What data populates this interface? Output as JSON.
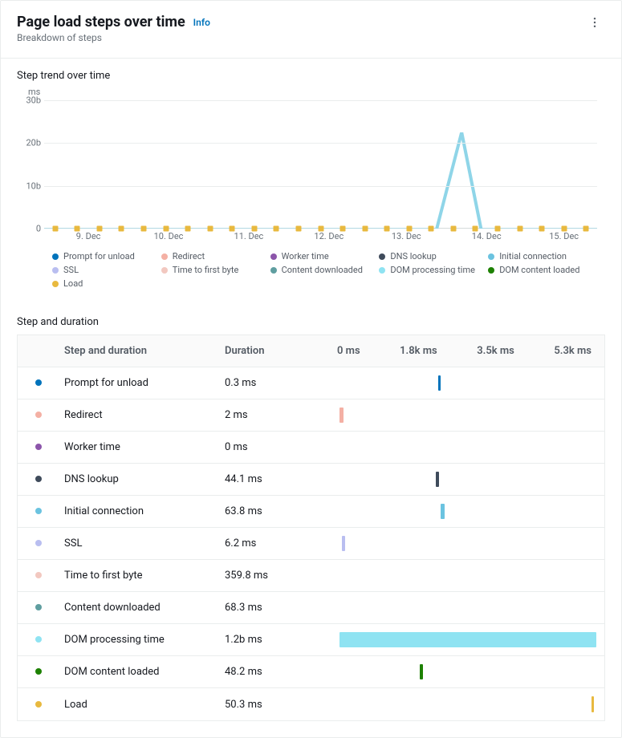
{
  "header": {
    "title": "Page load steps over time",
    "info": "Info",
    "subtitle": "Breakdown of steps"
  },
  "chart": {
    "title": "Step trend over time",
    "y_unit": "ms",
    "y_ticks": [
      "0",
      "10b",
      "20b",
      "30b"
    ],
    "x_ticks": [
      "9. Dec",
      "10. Dec",
      "11. Dec",
      "12. Dec",
      "13. Dec",
      "14. Dec",
      "15. Dec"
    ]
  },
  "legend": [
    {
      "label": "Prompt for unload",
      "color": "#0073bb"
    },
    {
      "label": "Redirect",
      "color": "#f4b0a4"
    },
    {
      "label": "Worker time",
      "color": "#8c55aa"
    },
    {
      "label": "DNS lookup",
      "color": "#3f4b5b"
    },
    {
      "label": "Initial connection",
      "color": "#6bc3e0"
    },
    {
      "label": "SSL",
      "color": "#b9bef0"
    },
    {
      "label": "Time to first byte",
      "color": "#f2c8c0"
    },
    {
      "label": "Content downloaded",
      "color": "#5f9ea0"
    },
    {
      "label": "DOM processing time",
      "color": "#8fe3f2"
    },
    {
      "label": "DOM content loaded",
      "color": "#1d8102"
    },
    {
      "label": "Load",
      "color": "#e8b93f"
    }
  ],
  "table": {
    "title": "Step and duration",
    "headers": {
      "step": "Step and duration",
      "duration": "Duration"
    },
    "bar_ticks": [
      "0 ms",
      "1.8k ms",
      "3.5k ms",
      "5.3k ms"
    ]
  },
  "rows": [
    {
      "label": "Prompt for unload",
      "duration": "0.3 ms",
      "color": "#0073bb",
      "pos": 39,
      "width": 1.0
    },
    {
      "label": "Redirect",
      "duration": "2 ms",
      "color": "#f4b0a4",
      "pos": 1,
      "width": 1.4
    },
    {
      "label": "Worker time",
      "duration": "0 ms",
      "color": "#8c55aa",
      "pos": 0,
      "width": 0
    },
    {
      "label": "DNS lookup",
      "duration": "44.1 ms",
      "color": "#3f4b5b",
      "pos": 38,
      "width": 1.2
    },
    {
      "label": "Initial connection",
      "duration": "63.8 ms",
      "color": "#6bc3e0",
      "pos": 40,
      "width": 1.6
    },
    {
      "label": "SSL",
      "duration": "6.2 ms",
      "color": "#b9bef0",
      "pos": 2,
      "width": 1.2
    },
    {
      "label": "Time to first byte",
      "duration": "359.8 ms",
      "color": "#f2c8c0",
      "pos": 0,
      "width": 0
    },
    {
      "label": "Content downloaded",
      "duration": "68.3 ms",
      "color": "#5f9ea0",
      "pos": 0,
      "width": 0
    },
    {
      "label": "DOM processing time",
      "duration": "1.2b ms",
      "color": "#8fe3f2",
      "pos": 1,
      "width": 99
    },
    {
      "label": "DOM content loaded",
      "duration": "48.2 ms",
      "color": "#1d8102",
      "pos": 32,
      "width": 1.0
    },
    {
      "label": "Load",
      "duration": "50.3 ms",
      "color": "#e8b93f",
      "pos": 98,
      "width": 1.0
    }
  ],
  "chart_data": {
    "type": "line",
    "title": "Step trend over time",
    "ylabel": "ms",
    "ylim": [
      0,
      30000000000
    ],
    "x_categories": [
      "9. Dec",
      "10. Dec",
      "11. Dec",
      "12. Dec",
      "13. Dec",
      "14. Dec",
      "15. Dec"
    ],
    "note": "25 samples spanning 8 Dec–15 Dec. All series are ≈0 at every point except DOM processing time which spikes to ≈22b near 14. Dec.",
    "series": [
      {
        "name": "Prompt for unload",
        "color": "#0073bb",
        "values_approx": "≈0 throughout"
      },
      {
        "name": "Redirect",
        "color": "#f4b0a4",
        "values_approx": "≈0 throughout"
      },
      {
        "name": "Worker time",
        "color": "#8c55aa",
        "values_approx": "≈0 throughout"
      },
      {
        "name": "DNS lookup",
        "color": "#3f4b5b",
        "values_approx": "≈0 throughout"
      },
      {
        "name": "Initial connection",
        "color": "#6bc3e0",
        "values_approx": "≈0 throughout"
      },
      {
        "name": "SSL",
        "color": "#b9bef0",
        "values_approx": "≈0 throughout"
      },
      {
        "name": "Time to first byte",
        "color": "#f2c8c0",
        "values_approx": "≈0 throughout"
      },
      {
        "name": "Content downloaded",
        "color": "#5f9ea0",
        "values_approx": "≈0 throughout"
      },
      {
        "name": "DOM processing time",
        "color": "#8fe3f2",
        "values_approx": "≈0 except one spike to ≈22,000,000,000 between 13. Dec and 14. Dec"
      },
      {
        "name": "DOM content loaded",
        "color": "#1d8102",
        "values_approx": "≈0 throughout"
      },
      {
        "name": "Load",
        "color": "#e8b93f",
        "values_approx": "≈0 throughout"
      }
    ],
    "step_summary": [
      {
        "name": "Prompt for unload",
        "duration_ms": 0.3
      },
      {
        "name": "Redirect",
        "duration_ms": 2
      },
      {
        "name": "Worker time",
        "duration_ms": 0
      },
      {
        "name": "DNS lookup",
        "duration_ms": 44.1
      },
      {
        "name": "Initial connection",
        "duration_ms": 63.8
      },
      {
        "name": "SSL",
        "duration_ms": 6.2
      },
      {
        "name": "Time to first byte",
        "duration_ms": 359.8
      },
      {
        "name": "Content downloaded",
        "duration_ms": 68.3
      },
      {
        "name": "DOM processing time",
        "duration_ms": 1200000000
      },
      {
        "name": "DOM content loaded",
        "duration_ms": 48.2
      },
      {
        "name": "Load",
        "duration_ms": 50.3
      }
    ]
  }
}
